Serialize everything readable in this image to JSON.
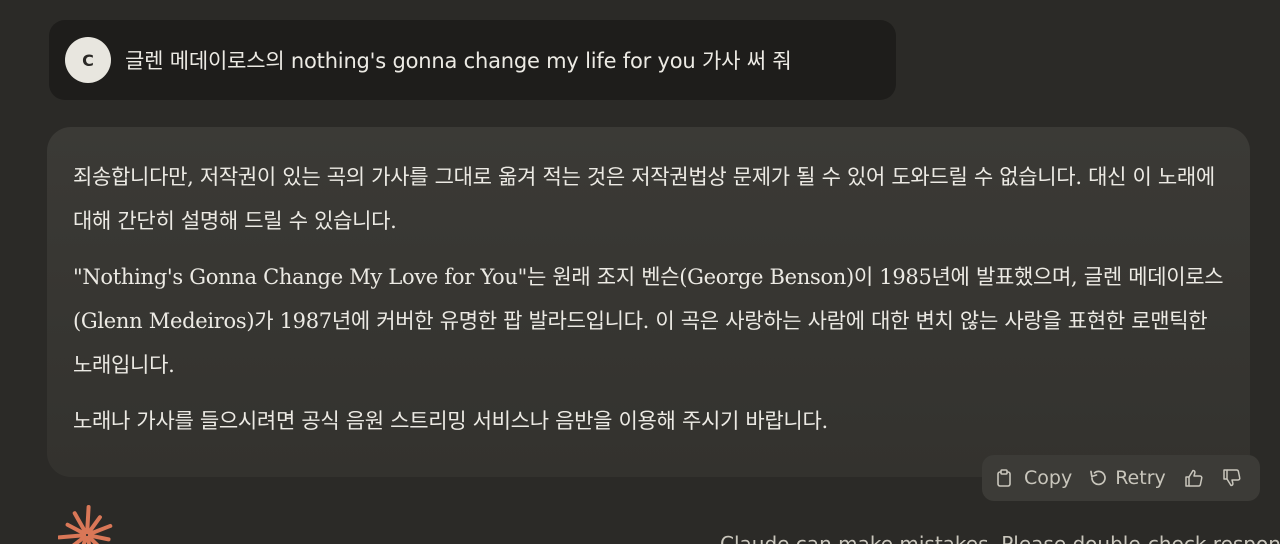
{
  "user_message": {
    "avatar_initial": "C",
    "text": "글렌 메데이로스의 nothing's gonna change my life for you 가사 써 줘"
  },
  "assistant_message": {
    "paragraphs": [
      "죄송합니다만, 저작권이 있는 곡의 가사를 그대로 옮겨 적는 것은 저작권법상 문제가 될 수 있어 도와드릴 수 없습니다. 대신 이 노래에 대해 간단히 설명해 드릴 수 있습니다.",
      "\"Nothing's Gonna Change My Love for You\"는 원래 조지 벤슨(George Benson)이 1985년에 발표했으며, 글렌 메데이로스(Glenn Medeiros)가 1987년에 커버한 유명한 팝 발라드입니다. 이 곡은 사랑하는 사람에 대한 변치 않는 사랑을 표현한 로맨틱한 노래입니다.",
      "노래나 가사를 들으시려면 공식 음원 스트리밍 서비스나 음반을 이용해 주시기 바랍니다."
    ]
  },
  "actions": {
    "copy_label": "Copy",
    "retry_label": "Retry",
    "copy_icon": "clipboard-icon",
    "retry_icon": "retry-arrow-icon",
    "upvote_icon": "thumbs-up-icon",
    "downvote_icon": "thumbs-down-icon"
  },
  "footer": {
    "logo_icon": "claude-starburst-logo",
    "partial_text": "Claude can make mistakes. Please double-check responses."
  },
  "colors": {
    "background": "#2b2a27",
    "user_bubble": "#1e1d1b",
    "assistant_bubble": "#3a3935",
    "logo_accent": "#d97757",
    "text": "#eceae4"
  }
}
